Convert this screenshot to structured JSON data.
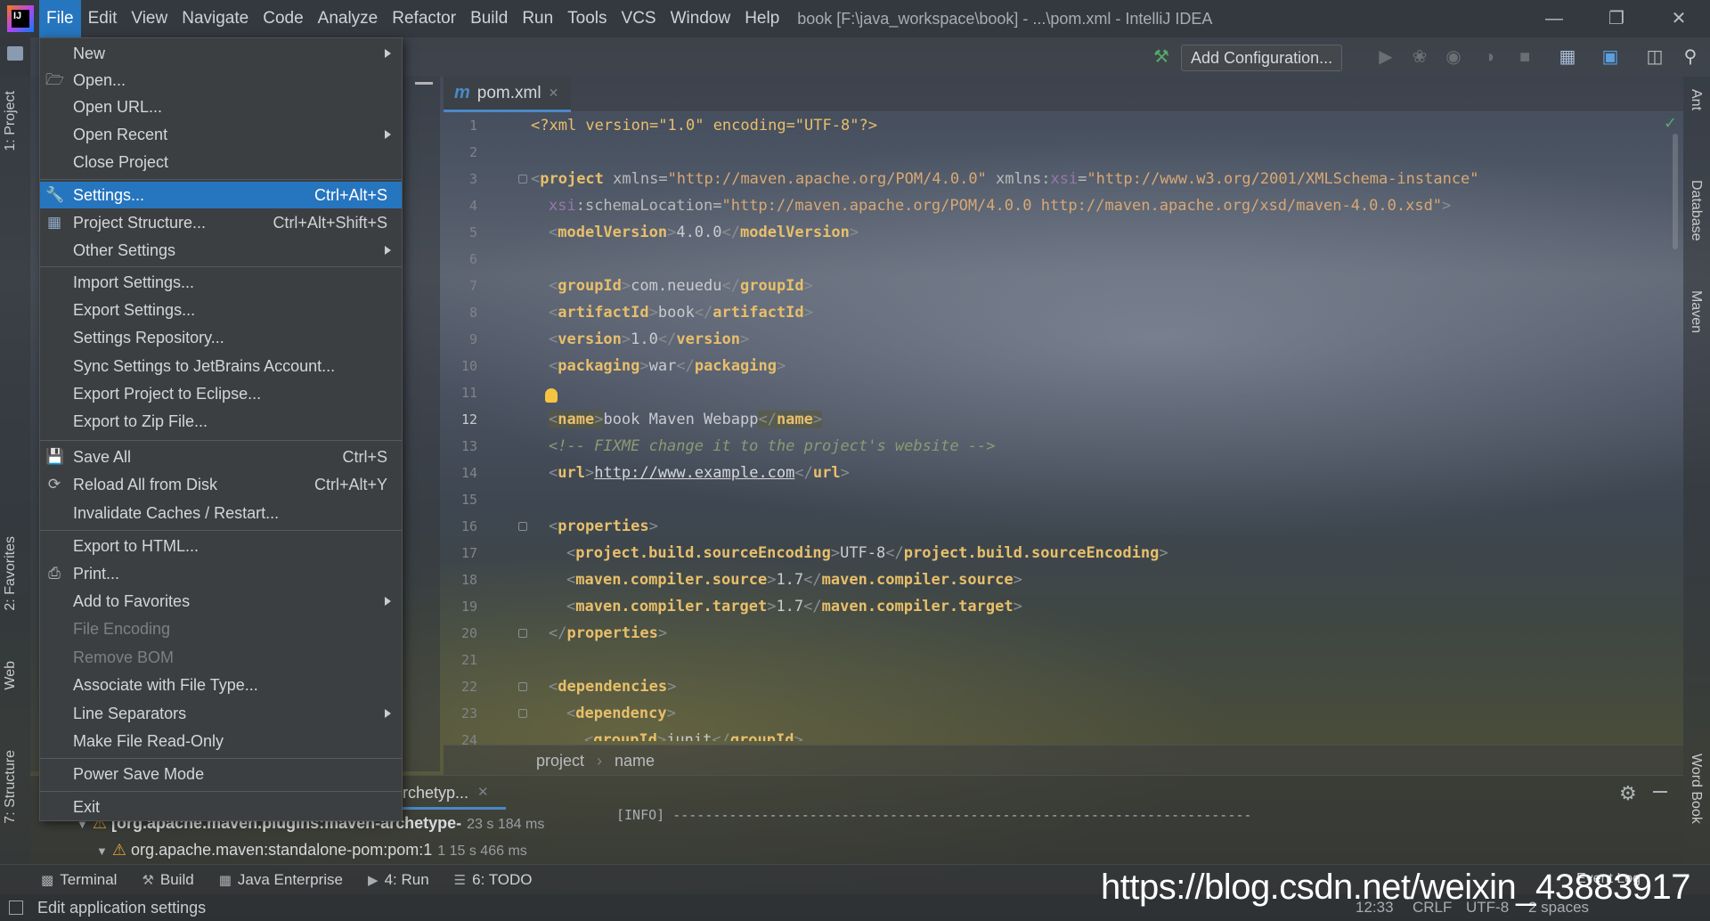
{
  "menubar": {
    "items": [
      "File",
      "Edit",
      "View",
      "Navigate",
      "Code",
      "Analyze",
      "Refactor",
      "Build",
      "Run",
      "Tools",
      "VCS",
      "Window",
      "Help"
    ],
    "active": "File"
  },
  "window_title": "book [F:\\java_workspace\\book] - ...\\pom.xml - IntelliJ IDEA",
  "toolbar": {
    "add_configuration": "Add Configuration..."
  },
  "left_tabs": [
    "1: Project",
    "2: Favorites",
    "Web",
    "7: Structure"
  ],
  "right_tabs": [
    "Ant",
    "Database",
    "Maven",
    "Word Book"
  ],
  "editor": {
    "tab_label": "pom.xml",
    "tab_icon": "m",
    "current_line": 12,
    "line_numbers": [
      "1",
      "2",
      "3",
      "4",
      "5",
      "6",
      "7",
      "8",
      "9",
      "10",
      "11",
      "12",
      "13",
      "14",
      "15",
      "16",
      "17",
      "18",
      "19",
      "20",
      "21",
      "22",
      "23",
      "24"
    ]
  },
  "code": {
    "l1": {
      "decl": "<?xml version=\"1.0\" encoding=\"UTF-8\"?>"
    },
    "l3": {
      "open": "<",
      "tag": "project",
      "a1": " xmlns=",
      "v1": "\"http://maven.apache.org/POM/4.0.0\"",
      "a2": " xmlns:",
      "ns": "xsi",
      "a3": "=",
      "v2": "\"http://www.w3.org/2001/XMLSchema-instance\""
    },
    "l4": {
      "ns": "xsi",
      "a1": ":schemaLocation=",
      "v1": "\"http://maven.apache.org/POM/4.0.0 http://maven.apache.org/xsd/maven-4.0.0.xsd\"",
      "close": ">"
    },
    "l5": {
      "tag": "modelVersion",
      "text": "4.0.0"
    },
    "l7": {
      "tag": "groupId",
      "text": "com.neuedu"
    },
    "l8": {
      "tag": "artifactId",
      "text": "book"
    },
    "l9": {
      "tag": "version",
      "text": "1.0"
    },
    "l10": {
      "tag": "packaging",
      "text": "war"
    },
    "l12": {
      "tag": "name",
      "text": "book Maven Webapp"
    },
    "l13": {
      "comment": "<!-- FIXME change it to the project's website -->"
    },
    "l14": {
      "tag": "url",
      "text": "http://www.example.com"
    },
    "l16": {
      "tag": "properties"
    },
    "l17": {
      "tag": "project.build.sourceEncoding",
      "text": "UTF-8"
    },
    "l18": {
      "tag": "maven.compiler.source",
      "text": "1.7"
    },
    "l19": {
      "tag": "maven.compiler.target",
      "text": "1.7"
    },
    "l20": {
      "tag": "properties"
    },
    "l22": {
      "tag": "dependencies"
    },
    "l23": {
      "tag": "dependency"
    },
    "l24": {
      "tag": "groupId",
      "text": "junit"
    }
  },
  "breadcrumb": [
    "project",
    "name"
  ],
  "file_menu": {
    "items": [
      {
        "label": "New",
        "submenu": true
      },
      {
        "label": "Open...",
        "icon": "folder-icon"
      },
      {
        "label": "Open URL..."
      },
      {
        "label": "Open Recent",
        "submenu": true
      },
      {
        "label": "Close Project"
      },
      {
        "label": "Settings...",
        "shortcut": "Ctrl+Alt+S",
        "icon": "wrench-icon",
        "selected": true
      },
      {
        "label": "Project Structure...",
        "shortcut": "Ctrl+Alt+Shift+S",
        "icon": "project-structure-icon"
      },
      {
        "label": "Other Settings",
        "submenu": true
      },
      {
        "label": "Import Settings..."
      },
      {
        "label": "Export Settings..."
      },
      {
        "label": "Settings Repository..."
      },
      {
        "label": "Sync Settings to JetBrains Account..."
      },
      {
        "label": "Export Project to Eclipse..."
      },
      {
        "label": "Export to Zip File..."
      },
      {
        "label": "Save All",
        "shortcut": "Ctrl+S",
        "icon": "save-icon"
      },
      {
        "label": "Reload All from Disk",
        "shortcut": "Ctrl+Alt+Y",
        "icon": "reload-icon"
      },
      {
        "label": "Invalidate Caches / Restart..."
      },
      {
        "label": "Export to HTML..."
      },
      {
        "label": "Print...",
        "icon": "printer-icon"
      },
      {
        "label": "Add to Favorites",
        "submenu": true
      },
      {
        "label": "File Encoding",
        "disabled": true
      },
      {
        "label": "Remove BOM",
        "disabled": true
      },
      {
        "label": "Associate with File Type..."
      },
      {
        "label": "Line Separators",
        "submenu": true
      },
      {
        "label": "Make File Read-Only"
      },
      {
        "label": "Power Save Mode"
      },
      {
        "label": "Exit"
      }
    ]
  },
  "run_panel": {
    "tab_label": "rchetyp...",
    "tree": [
      {
        "label": "[org.apache.maven.plugins:maven-archetype-",
        "time": "23 s 184 ms"
      },
      {
        "label": "org.apache.maven:standalone-pom:pom:1",
        "time": "1 15 s 466 ms"
      }
    ],
    "console": "[INFO] ------------------------------------------------------------------------"
  },
  "bottom_tools": [
    "Terminal",
    "Build",
    "Java Enterprise",
    "4: Run",
    "6: TODO"
  ],
  "status": {
    "message": "Edit application settings",
    "position": "12:33",
    "line_sep": "CRLF",
    "encoding": "UTF-8",
    "indent": "2 spaces",
    "event_log": "Event Log"
  },
  "watermark": "https://blog.csdn.net/weixin_43883917"
}
